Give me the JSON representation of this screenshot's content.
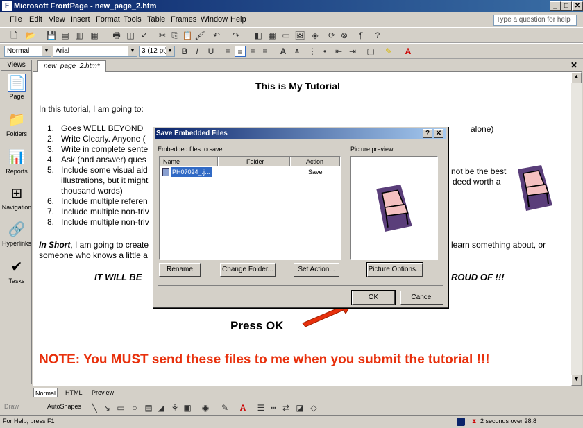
{
  "window": {
    "title": "Microsoft FrontPage - new_page_2.htm",
    "help_placeholder": "Type a question for help"
  },
  "menu": [
    "File",
    "Edit",
    "View",
    "Insert",
    "Format",
    "Tools",
    "Table",
    "Frames",
    "Window",
    "Help"
  ],
  "formatting": {
    "style": "Normal",
    "font": "Arial",
    "size": "3 (12 pt)"
  },
  "views": {
    "header": "Views",
    "items": [
      "Page",
      "Folders",
      "Reports",
      "Navigation",
      "Hyperlinks",
      "Tasks"
    ]
  },
  "doc_tab": "new_page_2.htm*",
  "document": {
    "heading": "This is My Tutorial",
    "intro": "In this tutorial, I am going to:",
    "list": [
      {
        "n": "1.",
        "text": "Goes WELL BEYOND"
      },
      {
        "n": "2.",
        "text": "Write Clearly. Anyone ("
      },
      {
        "n": "3.",
        "text": "Write in complete sente"
      },
      {
        "n": "4.",
        "text": "Ask (and answer) ques"
      },
      {
        "n": "5.",
        "text": "Include some visual aid"
      },
      {
        "n": "",
        "text": "illustrations, but it might"
      },
      {
        "n": "",
        "text": "thousand words)"
      },
      {
        "n": "6.",
        "text": "Include multiple referen"
      },
      {
        "n": "7.",
        "text": "Include multiple non-triv"
      },
      {
        "n": "8.",
        "text": "Include multiple non-triv"
      }
    ],
    "right_fragments": {
      "alone": "alone)",
      "best": "not be the best",
      "worth": "deed worth a"
    },
    "in_short_label": "In Short",
    "in_short_text": ", I am going to create",
    "in_short_end": "learn something about, or",
    "line2": "someone who knows a little a",
    "slogan_left": "IT WILL BE",
    "slogan_right": "ROUD OF !!!",
    "press_ok": "Press OK",
    "note": "NOTE: You MUST send these files to me when you submit the tutorial !!!"
  },
  "dialog": {
    "title": "Save Embedded Files",
    "files_label": "Embedded files to save:",
    "preview_label": "Picture preview:",
    "columns": [
      "Name",
      "Folder",
      "Action"
    ],
    "rows": [
      {
        "name": "PH07024_.j...",
        "folder": "",
        "action": "Save"
      }
    ],
    "buttons": {
      "rename": "Rename",
      "change_folder": "Change Folder...",
      "set_action": "Set Action...",
      "picture_options": "Picture Options...",
      "ok": "OK",
      "cancel": "Cancel"
    }
  },
  "view_tabs": [
    "Normal",
    "HTML",
    "Preview"
  ],
  "drawing": {
    "draw": "Draw",
    "autoshapes": "AutoShapes"
  },
  "status": {
    "left": "For Help, press F1",
    "right": "2 seconds over 28.8"
  },
  "colors": {
    "note_red": "#e8300c",
    "arrow_red": "#e8300c",
    "titlebar": "#0a246a"
  }
}
